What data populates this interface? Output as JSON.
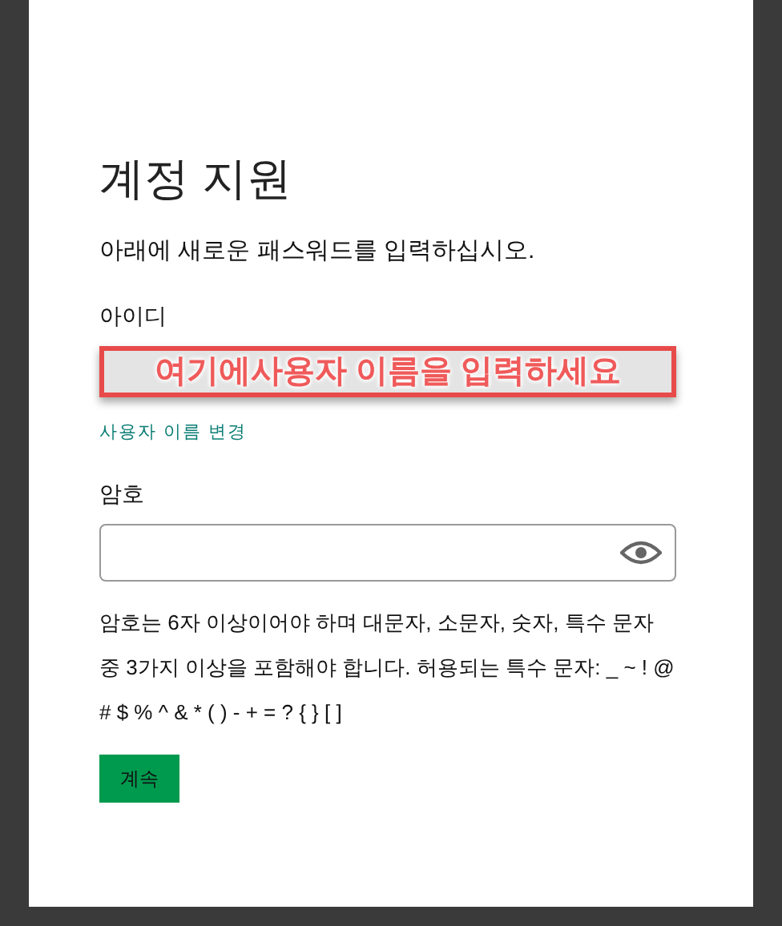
{
  "title": "계정 지원",
  "instruction": "아래에 새로운 패스워드를 입력하십시오.",
  "username": {
    "label": "아이디",
    "value": "여기에사용자 이름을 입력하세요"
  },
  "change_username_link": "사용자 이름 변경",
  "password": {
    "label": "암호"
  },
  "password_hint": "암호는 6자 이상이어야 하며 대문자, 소문자, 숫자, 특수 문자 중 3가지 이상을 포함해야 합니다. 허용되는 특수 문자: _ ~ ! @ # $ % ^ & * ( ) - + = ? { } [ ]",
  "continue_button": "계속"
}
